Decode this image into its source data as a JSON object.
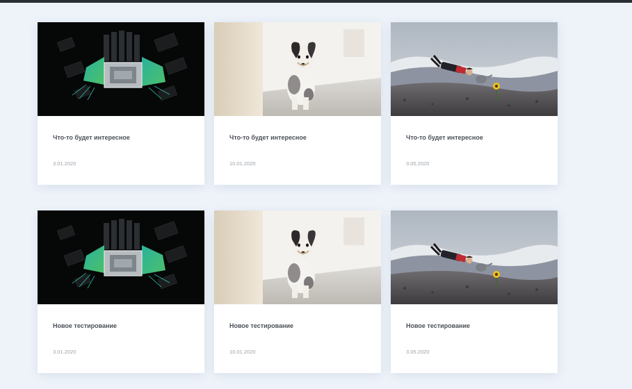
{
  "cards": [
    {
      "title": "Что-то будет интересное",
      "date": "3.01.2020",
      "image": "circuit-board"
    },
    {
      "title": "Что-то будет интересное",
      "date": "10.01.2020",
      "image": "puppy"
    },
    {
      "title": "Что-то будет интересное",
      "date": "3.05.2020",
      "image": "flying-man"
    },
    {
      "title": "Новое тестирование",
      "date": "3.01.2020",
      "image": "circuit-board"
    },
    {
      "title": "Новое тестирование",
      "date": "10.01.2020",
      "image": "puppy"
    },
    {
      "title": "Новое тестирование",
      "date": "3.05.2020",
      "image": "flying-man"
    }
  ],
  "colors": {
    "background": "#eef3fa",
    "topbar": "#2a2d31",
    "card": "#ffffff",
    "title": "#4a4f57",
    "date": "#9aa0a8"
  }
}
